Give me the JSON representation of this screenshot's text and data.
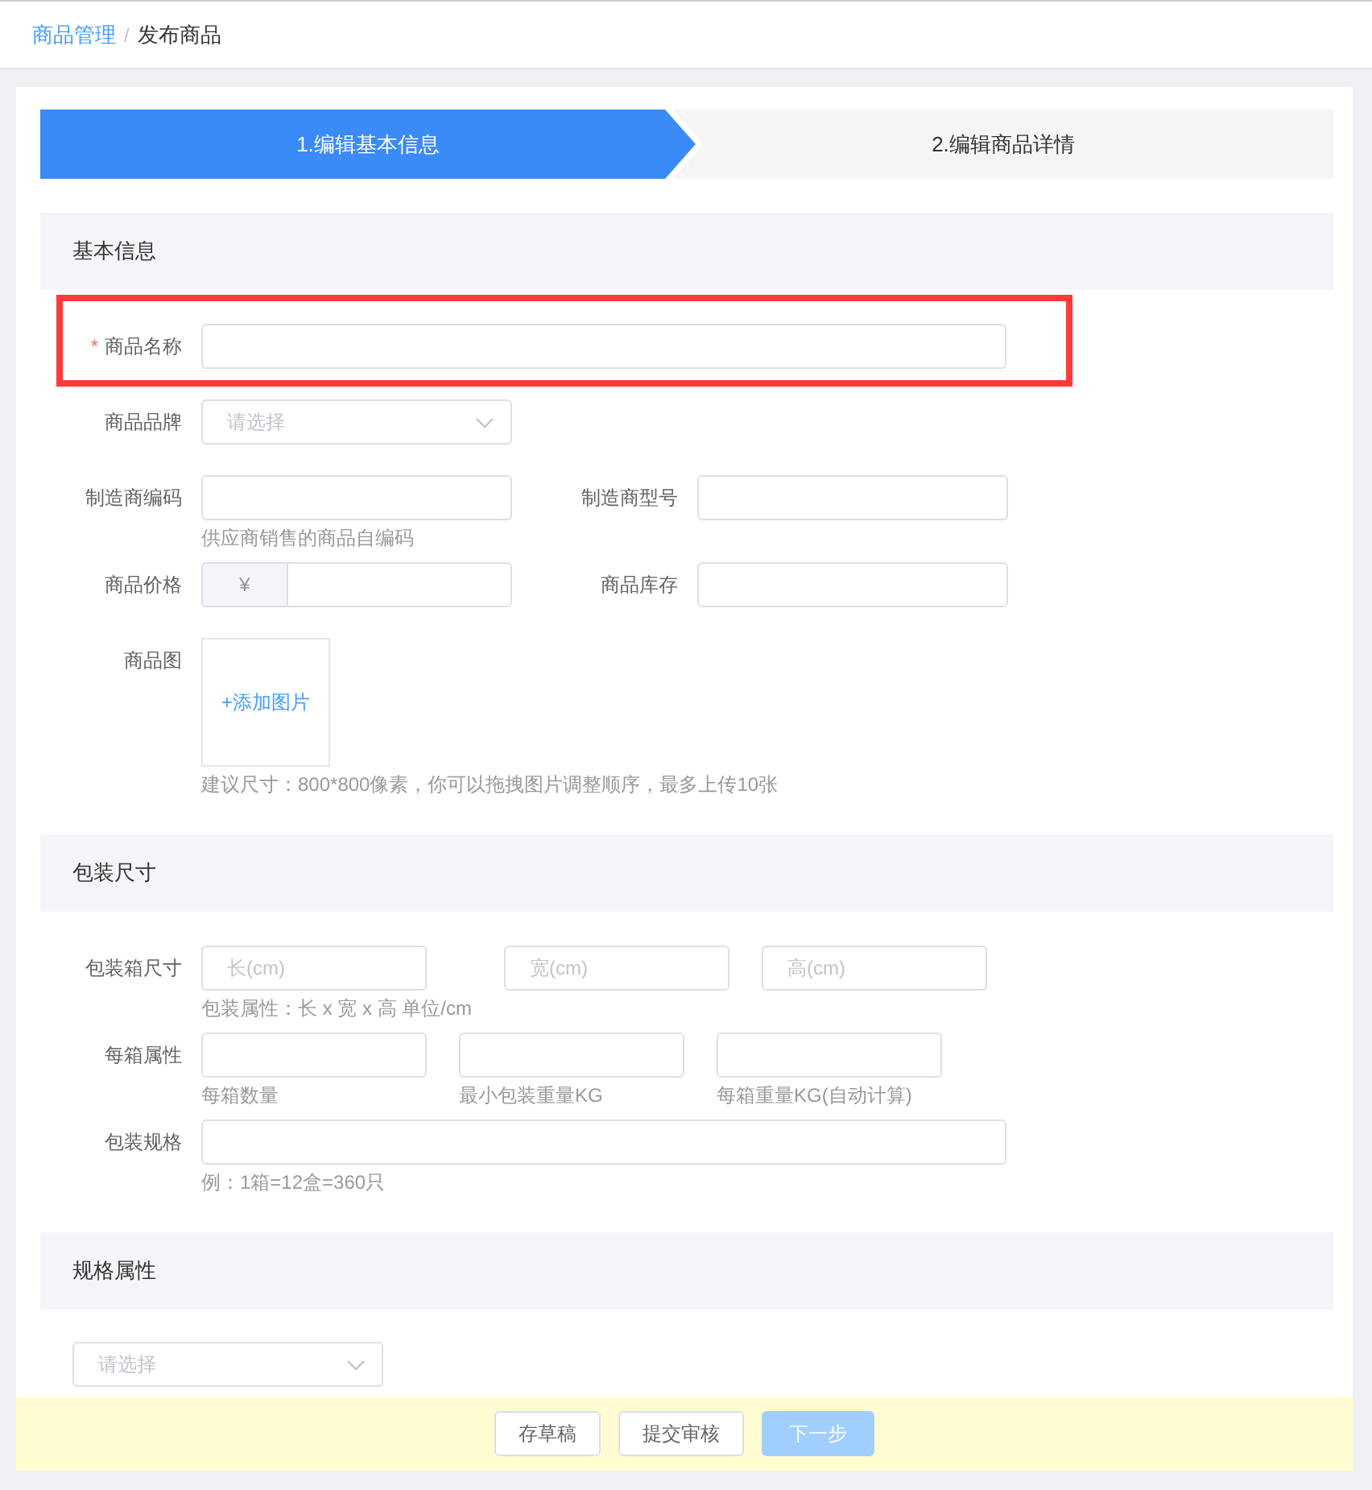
{
  "breadcrumb": {
    "items": [
      {
        "text": "商品管理",
        "link": true
      },
      {
        "text": "发布商品",
        "link": false
      }
    ],
    "separator": "/"
  },
  "steps": [
    {
      "label": "1.编辑基本信息",
      "selected": true
    },
    {
      "label": "2.编辑商品详情",
      "selected": false
    }
  ],
  "sections": [
    {
      "title": "基本信息",
      "rows": [
        {
          "label": "商品名称",
          "required_mark": "*",
          "highlighted": true,
          "cells": [
            {
              "kind": "wide-input"
            }
          ]
        },
        {
          "label": "商品品牌",
          "highlighted": false,
          "cells": [
            {
              "kind": "select",
              "placeholder": "请选择"
            }
          ]
        },
        {
          "label": "制造商编码",
          "highlighted": false,
          "cells": [
            {
              "kind": "input",
              "hint": "供应商销售的商品自编码"
            },
            {
              "kind": "input",
              "label": "制造商型号"
            }
          ]
        },
        {
          "label": "商品价格",
          "highlighted": false,
          "cells": [
            {
              "kind": "price",
              "prefix": "¥"
            },
            {
              "kind": "input",
              "label": "商品库存"
            }
          ]
        },
        {
          "label": "商品图",
          "highlighted": false,
          "cells": [
            {
              "kind": "upload",
              "text": "+添加图片",
              "hint": "建议尺寸：800*800像素，你可以拖拽图片调整顺序，最多上传10张"
            }
          ]
        }
      ]
    },
    {
      "title": "包装尺寸",
      "rows": [
        {
          "label": "包装箱尺寸",
          "highlighted": false,
          "cells": [
            {
              "kind": "box-input",
              "placeholder": "长(cm)",
              "hint": "包装属性：长 x 宽 x 高 单位/cm"
            },
            {
              "kind": "box-input",
              "placeholder": "宽(cm)"
            },
            {
              "kind": "box-input",
              "placeholder": "高(cm)"
            }
          ]
        },
        {
          "label": "每箱属性",
          "highlighted": false,
          "cells": [
            {
              "kind": "box-input",
              "hint": "每箱数量"
            },
            {
              "kind": "box-input",
              "hint": "最小包装重量KG"
            },
            {
              "kind": "box-input",
              "hint": "每箱重量KG(自动计算)"
            }
          ]
        },
        {
          "label": "包装规格",
          "highlighted": false,
          "cells": [
            {
              "kind": "wide-input",
              "hint": "例：1箱=12盒=360只"
            }
          ]
        }
      ]
    },
    {
      "title": "规格属性",
      "rows": [
        {
          "cells": [
            {
              "kind": "select",
              "placeholder": "请选择"
            }
          ]
        }
      ]
    }
  ],
  "footer": {
    "buttons": [
      {
        "label": "存草稿",
        "kind": "default",
        "disabled": false
      },
      {
        "label": "提交审核",
        "kind": "default",
        "disabled": false
      },
      {
        "label": "下一步",
        "kind": "primary",
        "disabled": true
      }
    ]
  }
}
